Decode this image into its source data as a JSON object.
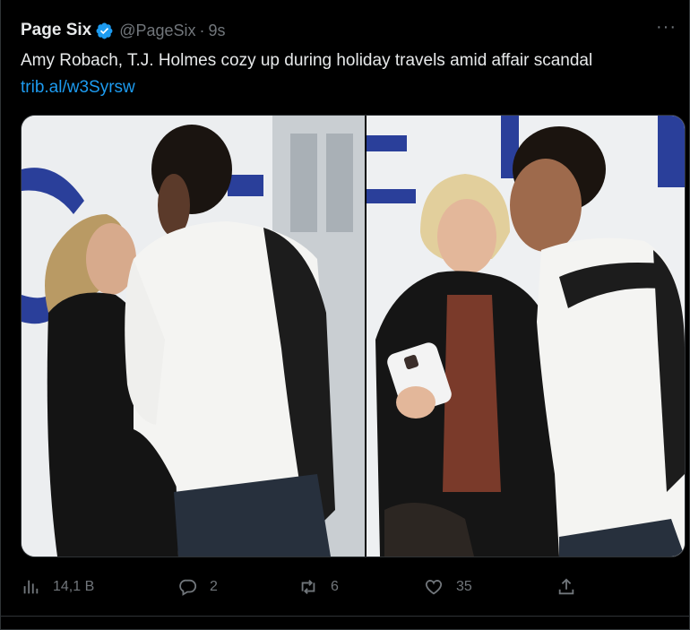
{
  "tweet": {
    "author_name": "Page Six",
    "handle": "@PageSix",
    "separator": "·",
    "time": "9s",
    "more_label": "···",
    "text": "Amy Robach, T.J. Holmes cozy up during holiday travels amid affair scandal",
    "link": "trib.al/w3Syrsw"
  },
  "actions": {
    "views": "14,1 B",
    "replies": "2",
    "retweets": "6",
    "likes": "35"
  },
  "colors": {
    "background": "#000000",
    "text": "#e7e9ea",
    "secondary": "#71767b",
    "accent": "#1d9bf0",
    "border": "#2f3336"
  },
  "icons": [
    "verified-badge-icon",
    "more-icon",
    "views-icon",
    "reply-icon",
    "retweet-icon",
    "like-icon",
    "share-icon"
  ]
}
